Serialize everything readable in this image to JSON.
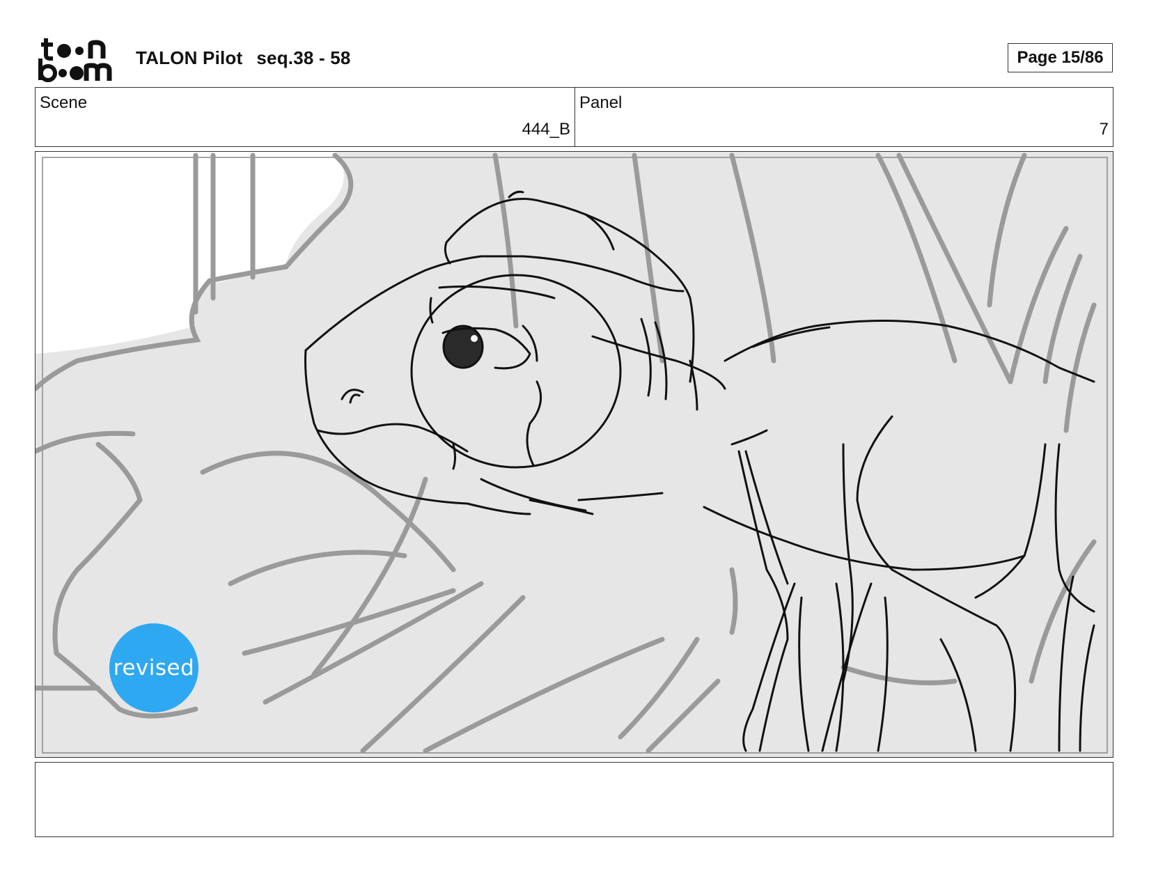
{
  "header": {
    "logo": {
      "text": "toon boom",
      "line1": "toon",
      "line2": "boom"
    },
    "project": "TALON Pilot",
    "sequence": "seq.38 - 58",
    "page": "Page 15/86"
  },
  "scene": {
    "label": "Scene",
    "value": "444_B"
  },
  "panel": {
    "label": "Panel",
    "value": "7"
  },
  "badge": {
    "label": "revised",
    "color": "#2fa8f2"
  },
  "notes": {
    "text": ""
  }
}
